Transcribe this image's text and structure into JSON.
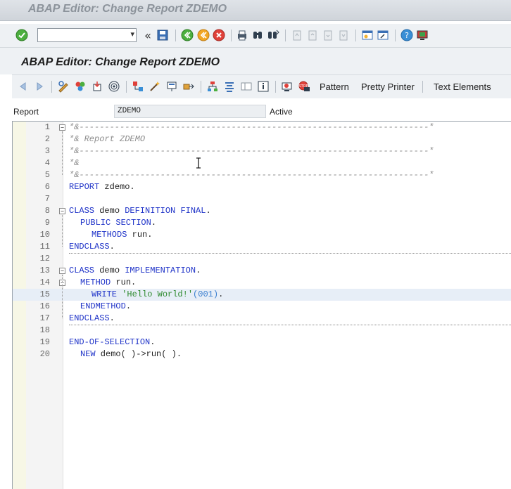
{
  "window": {
    "title": "ABAP Editor: Change Report ZDEMO"
  },
  "toolbar": {
    "command_field_value": "",
    "icons": [
      "enter-icon",
      "back-icon",
      "save-icon",
      "exit-icon",
      "cancel-icon",
      "print-icon",
      "find-icon",
      "find-next-icon",
      "first-page-icon",
      "prev-page-icon",
      "next-page-icon",
      "last-page-icon",
      "new-session-icon",
      "shortcut-icon",
      "help-icon",
      "customize-icon"
    ]
  },
  "page": {
    "title": "ABAP Editor: Change Report ZDEMO"
  },
  "app_toolbar": {
    "pattern_label": "Pattern",
    "pretty_printer_label": "Pretty Printer",
    "text_elements_label": "Text Elements"
  },
  "header_fields": {
    "report_label": "Report",
    "report_value": "ZDEMO",
    "status_value": "Active"
  },
  "editor": {
    "lines": [
      {
        "n": "1",
        "text": "*&---------------------------------------------------------------------*"
      },
      {
        "n": "2",
        "text": "*& Report ZDEMO"
      },
      {
        "n": "3",
        "text": "*&---------------------------------------------------------------------*"
      },
      {
        "n": "4",
        "text": "*&"
      },
      {
        "n": "5",
        "text": "*&---------------------------------------------------------------------*"
      },
      {
        "n": "6",
        "kw": "REPORT",
        "rest": " zdemo."
      },
      {
        "n": "7",
        "text": ""
      },
      {
        "n": "8",
        "kw": "CLASS",
        "mid": " demo ",
        "kw2": "DEFINITION FINAL",
        "rest": "."
      },
      {
        "n": "9",
        "kw": "PUBLIC SECTION",
        "rest": "."
      },
      {
        "n": "10",
        "kw": "METHODS",
        "rest": " run."
      },
      {
        "n": "11",
        "kw": "ENDCLASS",
        "rest": "."
      },
      {
        "n": "12",
        "text": ""
      },
      {
        "n": "13",
        "kw": "CLASS",
        "mid": " demo ",
        "kw2": "IMPLEMENTATION",
        "rest": "."
      },
      {
        "n": "14",
        "kw": "METHOD",
        "rest": " run."
      },
      {
        "n": "15",
        "kw": "WRITE",
        "str": "'Hello World!'",
        "num": "(001)",
        "rest": "."
      },
      {
        "n": "16",
        "kw": "ENDMETHOD",
        "rest": "."
      },
      {
        "n": "17",
        "kw": "ENDCLASS",
        "rest": "."
      },
      {
        "n": "18",
        "text": ""
      },
      {
        "n": "19",
        "kw": "END-OF-SELECTION",
        "rest": "."
      },
      {
        "n": "20",
        "kw": "NEW",
        "rest": " demo( )->run( )."
      }
    ]
  },
  "colors": {
    "keyword": "#1f33c8",
    "comment": "#8c8c8c",
    "string": "#2e8a2e",
    "number": "#3a7fd0",
    "highlight": "#e7eef7"
  }
}
